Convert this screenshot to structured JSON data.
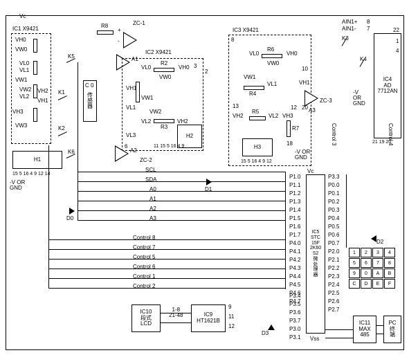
{
  "power": {
    "vc": "Vc"
  },
  "ic1": {
    "title": "IC1 X9421",
    "vh0": "VH0",
    "vw0": "VW0",
    "vl0": "VL0",
    "vl1": "VL1",
    "vw1": "VW1",
    "vw2": "VW2",
    "vl2": "VL2",
    "vh1": "VH1",
    "vh2": "VH2",
    "vh3": "VH3",
    "vw3": "VW3",
    "block": "H1",
    "pins": "15  5  16  4  9 12 14",
    "gnd": "-V OR\nGND"
  },
  "ic2": {
    "title": "IC2  X9421",
    "vl0": "VL0",
    "vh0": "VH0",
    "vw0": "VW0",
    "vh1": "VH1",
    "vw1": "VW1",
    "vl1": "VL1",
    "vw2": "VW2",
    "vl2": "VL2",
    "vh2": "VH2",
    "vl3": "VL3",
    "r2": "R2",
    "r3": "R3",
    "block": "H2",
    "pins": "11  15  5  16  4  9",
    "pin_top": "3",
    "pin_r": "2",
    "pin6": "6"
  },
  "ic3": {
    "title": "IC3  X9421",
    "vl0": "VL0",
    "vh0": "VH0",
    "vw0": "VW0",
    "vw1": "VW1",
    "vl1": "VL1",
    "vh1": "VH1",
    "vh2": "VH2",
    "vl2": "VL2",
    "vh3": "VH3",
    "r4": "R4",
    "r5": "R5",
    "r6": "R6",
    "r7": "R7",
    "block": "H3",
    "pins": "15  5  16  4  9 12",
    "gnd": "-V OR\nGND",
    "pin8": "8",
    "pin10": "10",
    "pin12": "12",
    "pin13": "13",
    "pin18": "18",
    "pin20": "20"
  },
  "ic4": {
    "title": "IC4\nAD\n7712AN",
    "ain1p": "AIN1+",
    "ain1m": "AIN1-",
    "pin7": "7",
    "pin8": "8",
    "pin22": "22",
    "pin19": "21 19 20",
    "pin1": "1",
    "pin4": "4",
    "gnd": "-V\nOR\nGND"
  },
  "ic5": {
    "title": "IC5\nSTC\n15F\n2K60\nS2\n微\n处\n理\n器",
    "vss": "Vss",
    "p1": [
      "P1.0",
      "P1.1",
      "P1.2",
      "P1.3",
      "P1.4",
      "P1.5",
      "P1.6",
      "P1.7"
    ],
    "p4": [
      "P4.0",
      "P4.1",
      "P4.2",
      "P4.3",
      "P4.4",
      "P4.5",
      "P4.6",
      "P4.7"
    ],
    "p3_left": [
      "P3.4",
      "P3.5",
      "P3.6",
      "P3.7",
      "P3.0",
      "P3.1"
    ],
    "p0": [
      "P0.0",
      "P0.1",
      "P0.2",
      "P0.3",
      "P0.4",
      "P0.5",
      "P0.6",
      "P0.7"
    ],
    "p2": [
      "P2.0",
      "P2.1",
      "P2.2",
      "P2.3",
      "P2.4",
      "P2.5",
      "P2.6",
      "P2.7"
    ],
    "p33": "P3.3"
  },
  "amps": {
    "a1": "A1",
    "a2": "A2",
    "a3": "A3",
    "zc1": "ZC-1",
    "zc2": "ZC-2",
    "zc3": "ZC-3"
  },
  "switches": {
    "k1": "K1",
    "k2": "K2",
    "k3": "K3",
    "k4": "K4",
    "k5": "K5",
    "k6": "K6"
  },
  "resistors": {
    "r8": "R8"
  },
  "sensor": {
    "c0": "C 0",
    "label": "传\n感\n器"
  },
  "bus": {
    "scl": "SCL",
    "sda": "SDA",
    "a0": "A0",
    "a1": "A1",
    "a2": "A2",
    "a3": "A3"
  },
  "diodes": {
    "d0": "D0",
    "d1": "D1",
    "d2": "D2",
    "d3": "D3"
  },
  "controls": {
    "c1": "Control 1",
    "c2": "Control 2",
    "c3": "Control 3",
    "c4": "Control 4",
    "c5": "Control 5",
    "c6": "Control 6",
    "c7": "Control 7",
    "c8": "Control 8"
  },
  "ic9": {
    "title": "IC9\nHT1621B",
    "pins": "1-8\n21-48",
    "p9": "9",
    "p11": "11",
    "p12": "12"
  },
  "ic10": {
    "title": "IC10\n段式\nLCD"
  },
  "ic11": {
    "title": "IC11\nMAX\n485"
  },
  "pc": {
    "title": "PC\n终\n端"
  },
  "keypad": [
    "1",
    "2",
    "3",
    "4",
    "5",
    "6",
    "7",
    "8",
    "9",
    "0",
    "A",
    "B",
    "C",
    "D",
    "E",
    "F"
  ]
}
